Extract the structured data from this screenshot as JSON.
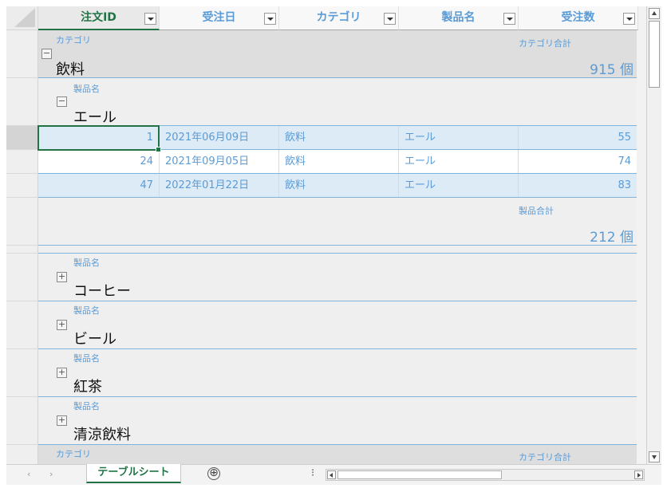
{
  "columns": [
    "注文ID",
    "受注日",
    "カテゴリ",
    "製品名",
    "受注数"
  ],
  "labels": {
    "category": "カテゴリ",
    "category_total": "カテゴリ合計",
    "product": "製品名",
    "product_total": "製品合計"
  },
  "category_group": {
    "name": "飲料",
    "total": "915 個",
    "toggle": "−"
  },
  "product_group": {
    "name": "エール",
    "total": "212 個",
    "toggle": "−"
  },
  "rows": [
    {
      "id": "1",
      "date": "2021年06月09日",
      "category": "飲料",
      "product": "エール",
      "qty": "55"
    },
    {
      "id": "24",
      "date": "2021年09月05日",
      "category": "飲料",
      "product": "エール",
      "qty": "74"
    },
    {
      "id": "47",
      "date": "2022年01月22日",
      "category": "飲料",
      "product": "エール",
      "qty": "83"
    }
  ],
  "collapsed_products": [
    {
      "name": "コーヒー",
      "toggle": "+"
    },
    {
      "name": "ビール",
      "toggle": "+"
    },
    {
      "name": "紅茶",
      "toggle": "+"
    },
    {
      "name": "清涼飲料",
      "toggle": "+"
    }
  ],
  "sheet_tab": "テーブルシート",
  "add_sheet": "⊕",
  "tab_nav": {
    "prev": "‹",
    "next": "›"
  },
  "split_handle": "⁝",
  "colors": {
    "accent": "#217346",
    "header_text": "#5b9bd5",
    "alt_row": "#ddebf7"
  }
}
